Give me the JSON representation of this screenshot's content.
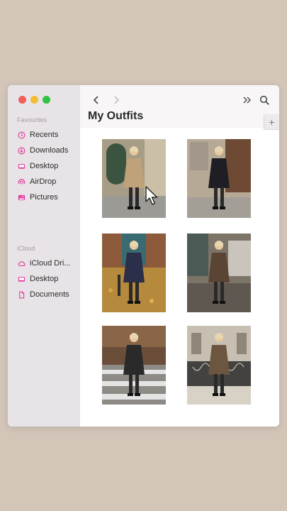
{
  "window": {
    "title": "My Outfits",
    "add_tab_label": "+"
  },
  "sidebar": {
    "favourites_label": "Favourites",
    "favourites": [
      {
        "label": "Recents",
        "icon": "clock-icon"
      },
      {
        "label": "Downloads",
        "icon": "download-icon"
      },
      {
        "label": "Desktop",
        "icon": "desktop-icon"
      },
      {
        "label": "AirDrop",
        "icon": "airdrop-icon"
      },
      {
        "label": "Pictures",
        "icon": "pictures-icon"
      }
    ],
    "icloud_label": "iCloud",
    "icloud": [
      {
        "label": "iCloud Dri...",
        "icon": "cloud-icon"
      },
      {
        "label": "Desktop",
        "icon": "desktop-icon"
      },
      {
        "label": "Documents",
        "icon": "document-icon"
      }
    ]
  },
  "toolbar": {
    "back_icon": "chevron-left-icon",
    "forward_icon": "chevron-right-icon",
    "more_icon": "double-chevron-icon",
    "search_icon": "search-icon"
  },
  "colors": {
    "accent": "#e040a0",
    "sidebar_bg": "#e8e3e6",
    "page_bg": "#d3c6b9"
  },
  "photos": [
    {
      "name": "outfit-photo-1",
      "scene": "street-doorway",
      "bg": "#a79c85",
      "coat": "#bfa27a"
    },
    {
      "name": "outfit-photo-2",
      "scene": "building-facade",
      "bg": "#b6a996",
      "coat": "#1e1e24"
    },
    {
      "name": "outfit-photo-3",
      "scene": "autumn-leaves",
      "bg": "#b58a3c",
      "coat": "#2b2f4a"
    },
    {
      "name": "outfit-photo-4",
      "scene": "stone-steps",
      "bg": "#7d7468",
      "coat": "#5a4434"
    },
    {
      "name": "outfit-photo-5",
      "scene": "crosswalk-cafe",
      "bg": "#8e8a86",
      "coat": "#2a2a2a"
    },
    {
      "name": "outfit-photo-6",
      "scene": "balcony-railing",
      "bg": "#c6bfb2",
      "coat": "#6c5640"
    }
  ]
}
